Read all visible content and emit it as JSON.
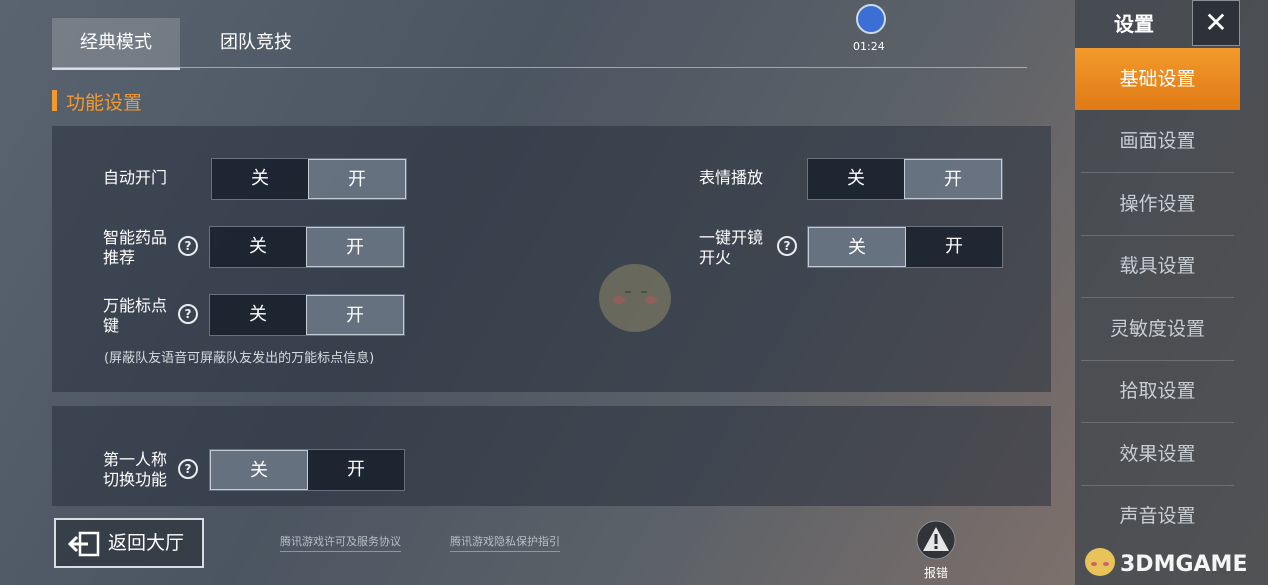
{
  "tabs": [
    {
      "label": "经典模式",
      "active": true
    },
    {
      "label": "团队竞技",
      "active": false
    }
  ],
  "recorder": {
    "time": "01:24"
  },
  "section_title": "功能设置",
  "settings": {
    "auto_door": {
      "label": "自动开门",
      "off": "关",
      "on": "开",
      "selected": "on"
    },
    "med_recommend": {
      "label1": "智能药品",
      "label2": "推荐",
      "off": "关",
      "on": "开",
      "selected": "on"
    },
    "marker_key": {
      "label1": "万能标点",
      "label2": "键",
      "off": "关",
      "on": "开",
      "selected": "on"
    },
    "marker_note": "(屏蔽队友语音可屏蔽队友发出的万能标点信息)",
    "emote_play": {
      "label": "表情播放",
      "off": "关",
      "on": "开",
      "selected": "on"
    },
    "scope_fire": {
      "label1": "一键开镜",
      "label2": "开火",
      "off": "关",
      "on": "开",
      "selected": "off"
    },
    "first_person": {
      "label1": "第一人称",
      "label2": "切换功能",
      "off": "关",
      "on": "开",
      "selected": "off"
    }
  },
  "help_glyph": "?",
  "sidebar": {
    "title": "设置",
    "close": "✕",
    "items": [
      {
        "label": "基础设置",
        "active": true
      },
      {
        "label": "画面设置"
      },
      {
        "label": "操作设置"
      },
      {
        "label": "载具设置"
      },
      {
        "label": "灵敏度设置"
      },
      {
        "label": "拾取设置"
      },
      {
        "label": "效果设置"
      },
      {
        "label": "声音设置"
      }
    ]
  },
  "footer": {
    "back_label": "返回大厅",
    "link1": "腾讯游戏许可及服务协议",
    "link2": "腾讯游戏隐私保护指引",
    "report": "报错"
  },
  "watermark": "3DMGAME",
  "colors": {
    "accent": "#f29a2e",
    "active_tab": "#e07a16"
  }
}
